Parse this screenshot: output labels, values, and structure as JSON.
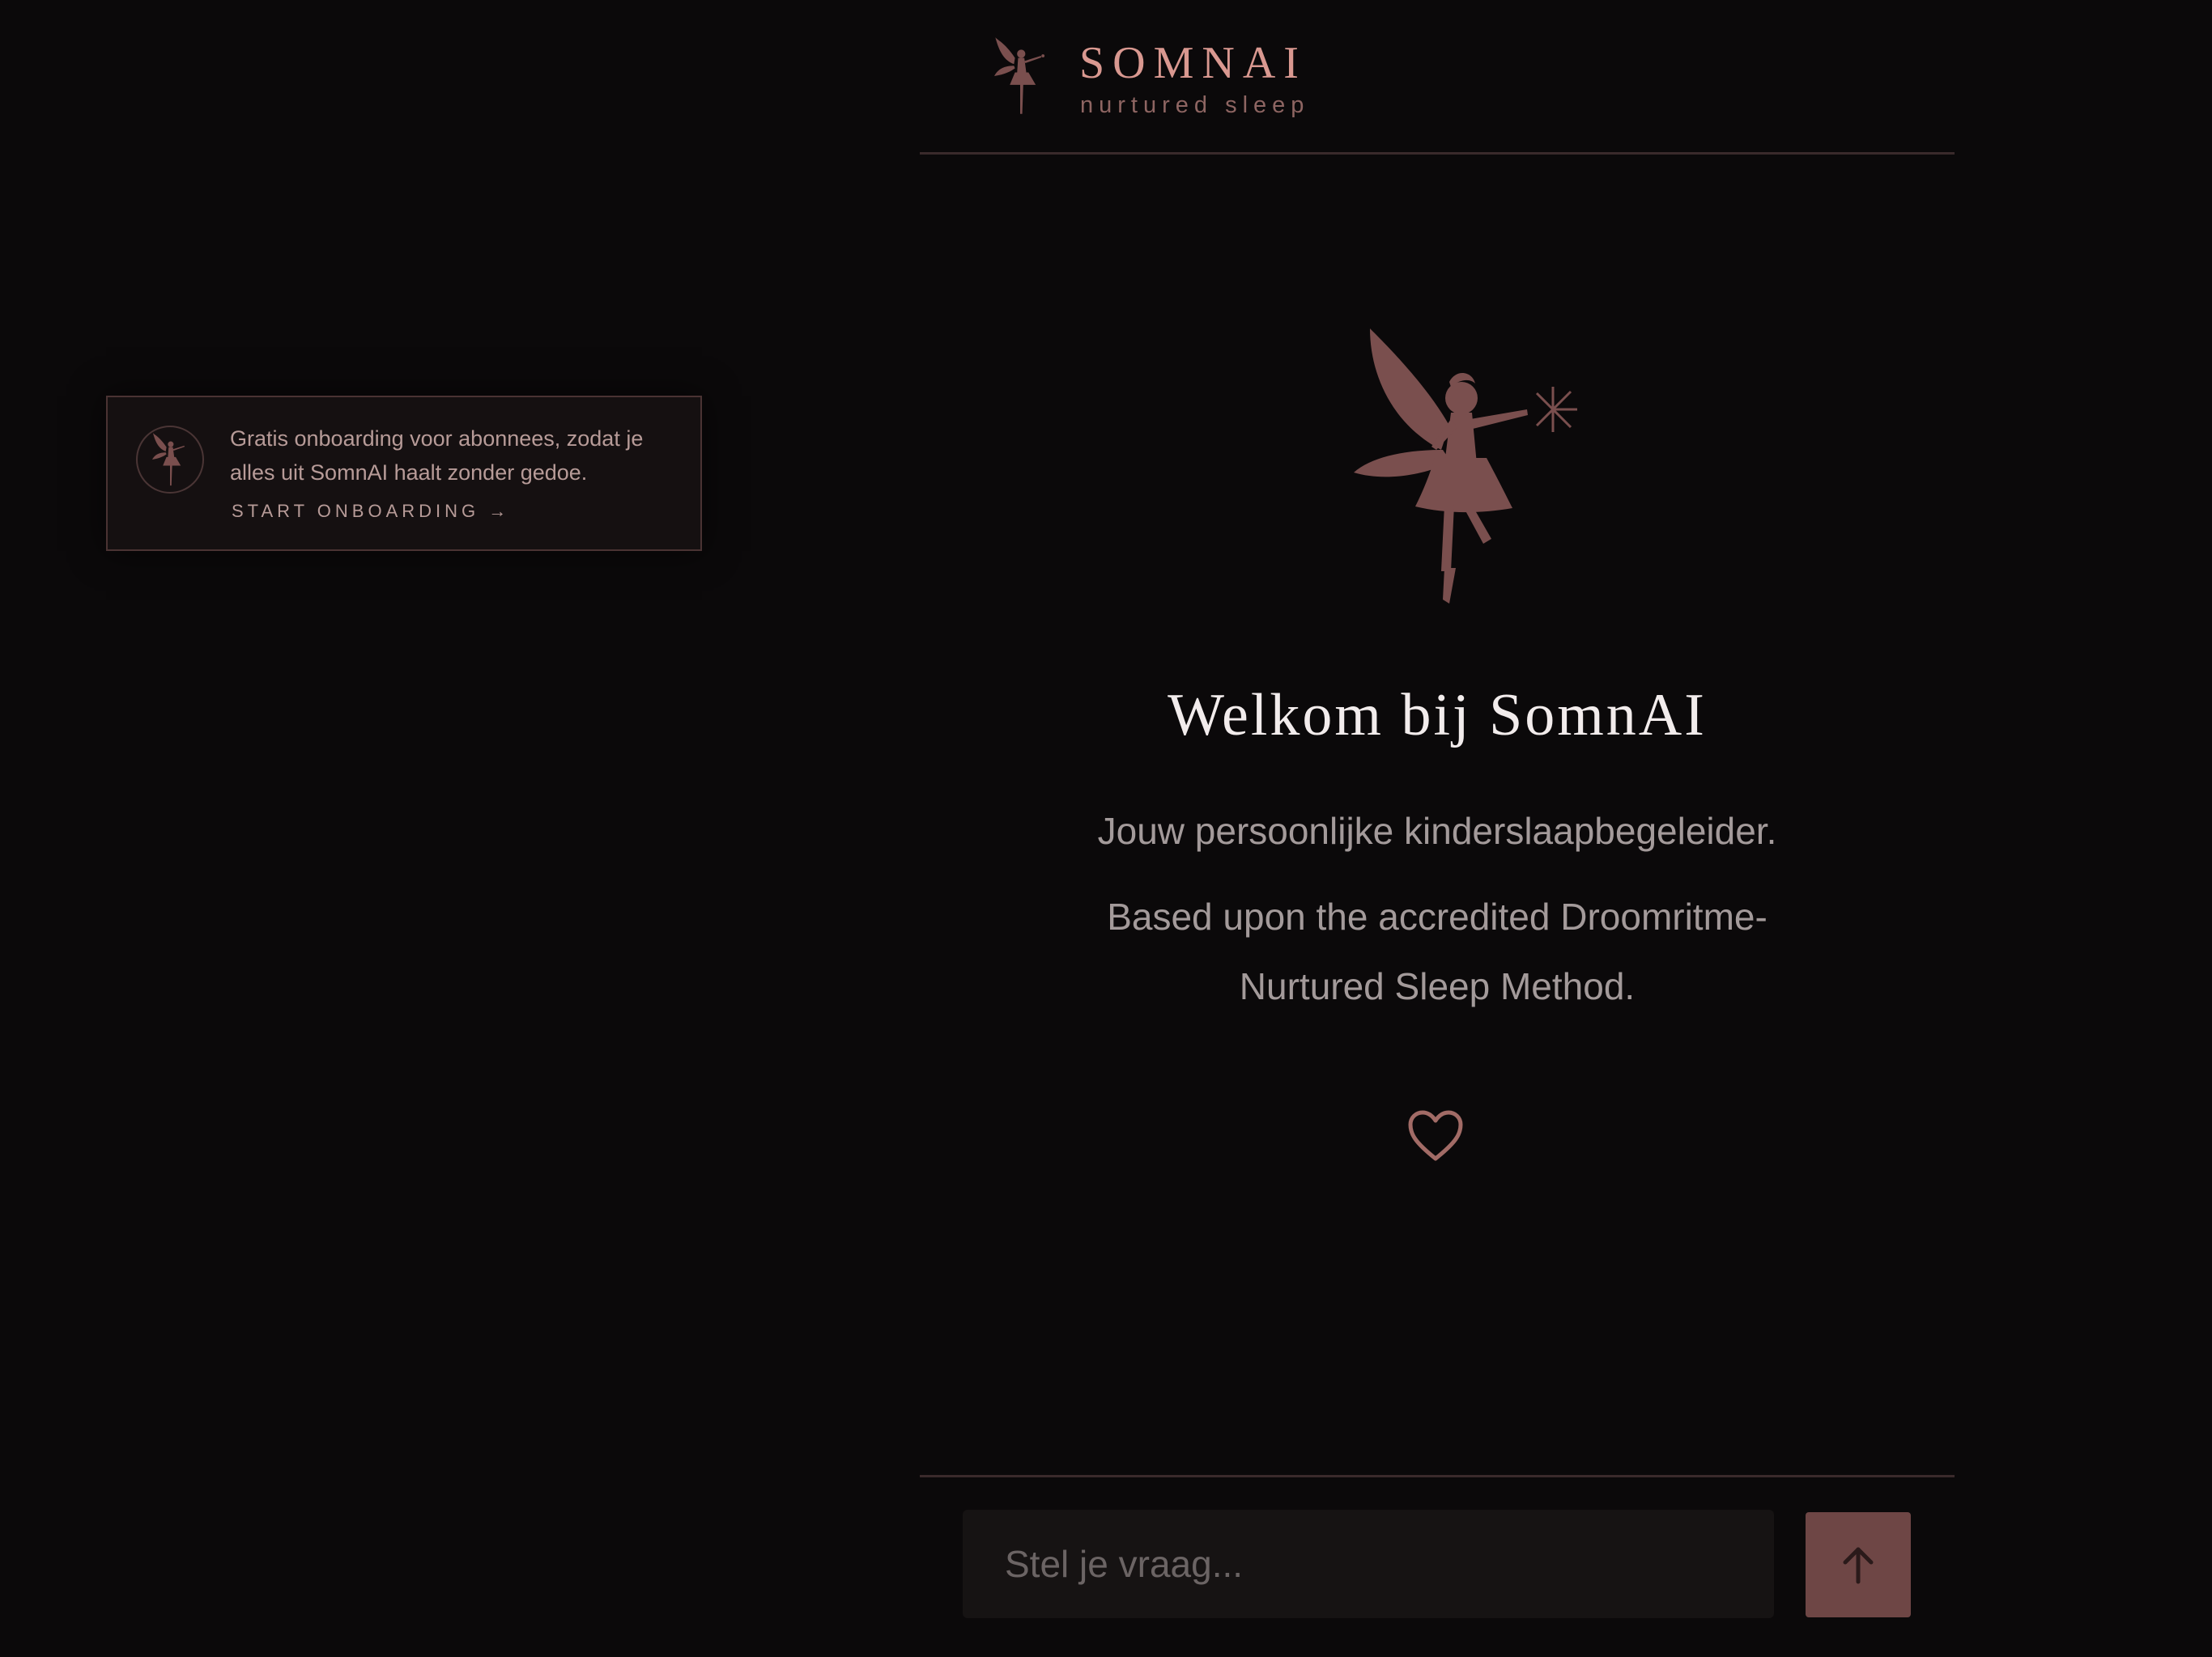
{
  "brand": {
    "name": "SOMNAI",
    "tagline": "nurtured sleep",
    "logo_icon": "fairy-icon"
  },
  "onboarding": {
    "text": "Gratis onboarding voor abonnees, zodat je alles uit SomnAI haalt zonder gedoe.",
    "cta_label": "START ONBOARDING →",
    "icon": "fairy-icon"
  },
  "hero": {
    "icon": "fairy-icon",
    "title": "Welkom bij SomnAI",
    "subtitle": "Jouw persoonlijke kinderslaapbegeleider.",
    "method": "Based upon the accredited Droomritme-Nurtured Sleep Method.",
    "heart_icon": "heart-icon"
  },
  "chat": {
    "placeholder": "Stel je vraag...",
    "send_icon": "arrow-up-icon"
  },
  "colors": {
    "background": "#0b090a",
    "accent": "#d99890",
    "fairy": "#7a4f4e",
    "send_button": "#6e4645"
  }
}
